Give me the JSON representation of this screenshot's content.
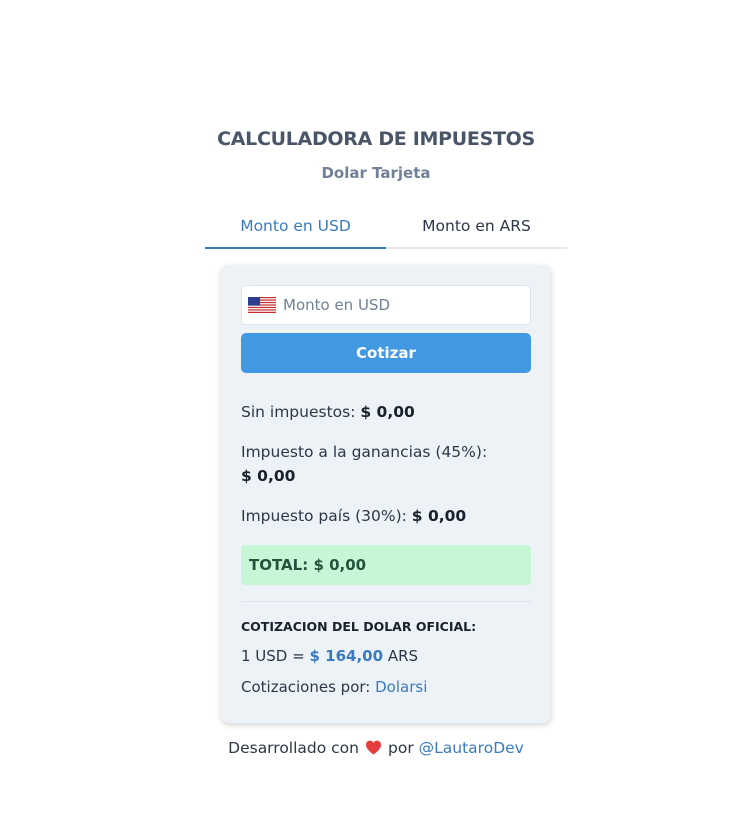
{
  "header": {
    "title": "CALCULADORA DE IMPUESTOS",
    "subtitle": "Dolar Tarjeta"
  },
  "tabs": [
    {
      "label": "Monto en USD",
      "active": true
    },
    {
      "label": "Monto en ARS",
      "active": false
    }
  ],
  "form": {
    "flag_icon": "us-flag-icon",
    "input_placeholder": "Monto en USD",
    "input_value": "",
    "submit_label": "Cotizar"
  },
  "results": {
    "sin_impuestos_label": "Sin impuestos:",
    "sin_impuestos_value": "$ 0,00",
    "ganancias_label": "Impuesto a la ganancias (45%):",
    "ganancias_value": "$ 0,00",
    "pais_label": "Impuesto país (30%):",
    "pais_value": "$ 0,00",
    "total_label": "TOTAL:",
    "total_value": "$ 0,00"
  },
  "cotizacion": {
    "heading": "COTIZACION DEL DOLAR OFICIAL:",
    "rate_prefix": "1 USD =",
    "rate_value": "$ 164,00",
    "rate_suffix": "ARS",
    "source_label": "Cotizaciones por:",
    "source_link": "Dolarsi"
  },
  "footer": {
    "prefix": "Desarrollado con",
    "heart_icon": "heart-icon",
    "middle": "por",
    "author_link": "@LautaroDev"
  },
  "colors": {
    "accent": "#3a7bbf",
    "button": "#4299e1",
    "total_bg": "#c6f6d5",
    "card_bg": "#edf2f7",
    "heart": "#e53e3e"
  }
}
